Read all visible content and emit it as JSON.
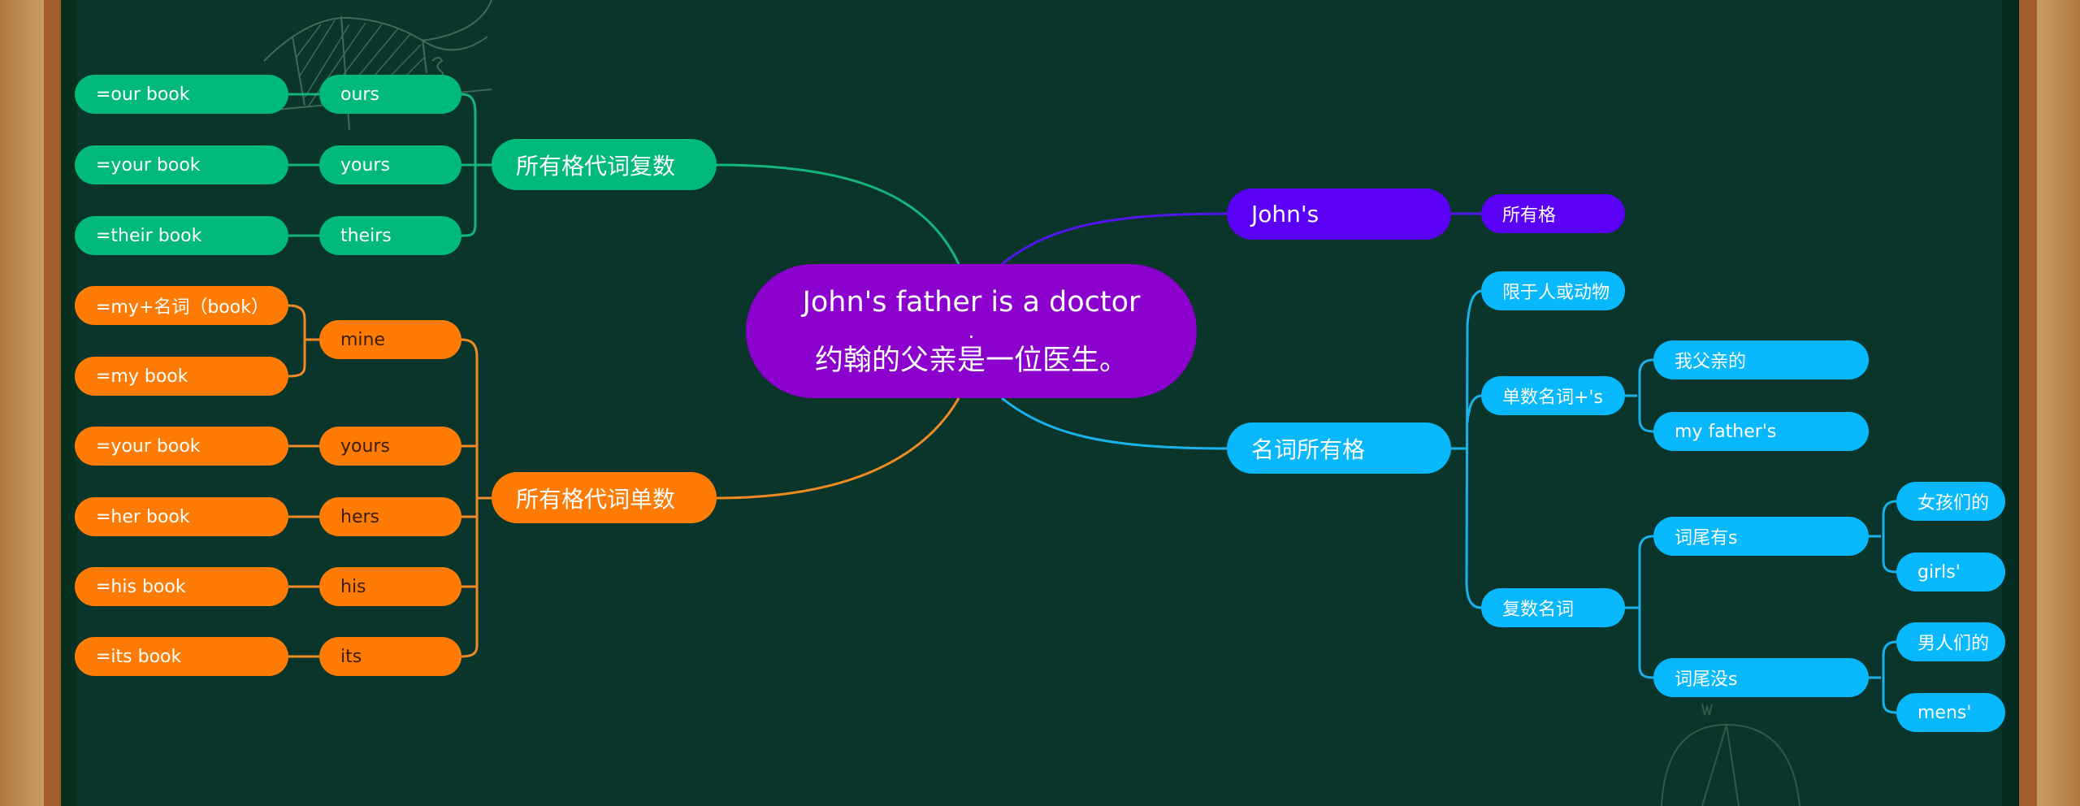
{
  "theme": {
    "board": "#09352a",
    "center": "#8b00cc",
    "green": "#00b97a",
    "orange": "#fe7c06",
    "violet": "#5a00f5",
    "blue": "#08b8fc",
    "frame_wood": "#a35d2c"
  },
  "central": {
    "line1": "John's father is a doctor",
    "line2": ".",
    "line3": "约翰的父亲是一位医生。"
  },
  "left": {
    "plural": {
      "label": "所有格代词复数",
      "items": [
        {
          "pronoun": "ours",
          "equals": "=our book"
        },
        {
          "pronoun": "yours",
          "equals": "=your book"
        },
        {
          "pronoun": "theirs",
          "equals": "=their book"
        }
      ]
    },
    "singular": {
      "label": "所有格代词单数",
      "items": [
        {
          "pronoun": "mine",
          "equals": [
            "=my+名词（book）",
            "=my book"
          ]
        },
        {
          "pronoun": "yours",
          "equals": [
            "=your book"
          ]
        },
        {
          "pronoun": "hers",
          "equals": [
            "=her book"
          ]
        },
        {
          "pronoun": "his",
          "equals": [
            "=his book"
          ]
        },
        {
          "pronoun": "its",
          "equals": [
            "=its book"
          ]
        }
      ]
    }
  },
  "right": {
    "johns": {
      "label": "John's",
      "child": "所有格"
    },
    "noun_possessive": {
      "label": "名词所有格",
      "children": [
        {
          "label": "限于人或动物"
        },
        {
          "label": "单数名词+'s",
          "children": [
            {
              "label": "我父亲的"
            },
            {
              "label": "my father's"
            }
          ]
        },
        {
          "label": "复数名词",
          "children": [
            {
              "label": "词尾有s",
              "children": [
                {
                  "label": "女孩们的"
                },
                {
                  "label": "girls'"
                }
              ]
            },
            {
              "label": "词尾没s",
              "children": [
                {
                  "label": "男人们的"
                },
                {
                  "label": "mens'"
                }
              ]
            }
          ]
        }
      ]
    }
  }
}
